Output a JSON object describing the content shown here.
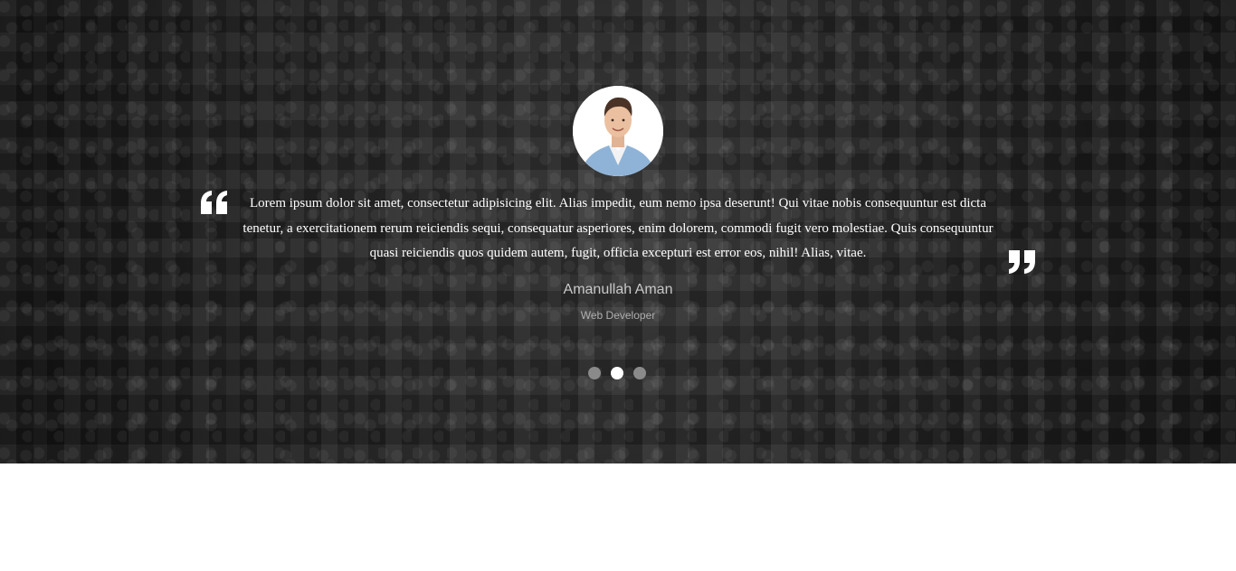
{
  "testimonial": {
    "quote": "Lorem ipsum dolor sit amet, consectetur adipisicing elit. Alias impedit, eum nemo ipsa deserunt! Qui vitae nobis consequuntur est dicta tenetur, a exercitationem rerum reiciendis sequi, consequatur asperiores, enim dolorem, commodi fugit vero molestiae. Quis consequuntur quasi reiciendis quos quidem autem, fugit, officia excepturi est error eos, nihil! Alias, vitae.",
    "name": "Amanullah Aman",
    "role": "Web Developer",
    "open_quote_icon": "quote-open-icon",
    "close_quote_icon": "quote-close-icon"
  },
  "pagination": {
    "dots": 3,
    "active_index": 1
  },
  "colors": {
    "text": "#ffffff",
    "dot_inactive": "#8a8a8a",
    "dot_active": "#ffffff"
  }
}
